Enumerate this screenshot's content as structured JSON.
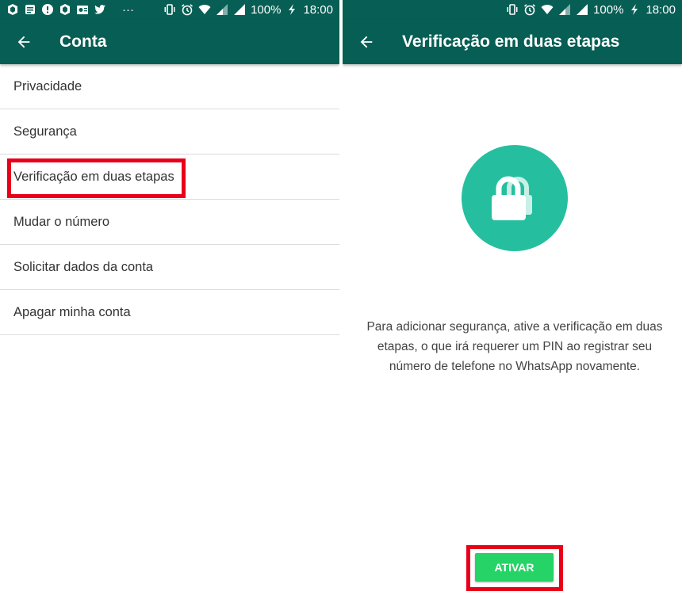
{
  "colors": {
    "header": "#075e54",
    "accent": "#25bfa0",
    "button": "#25d366",
    "highlight": "#e8001a"
  },
  "status_bar": {
    "battery": "100%",
    "time": "18:00",
    "overflow": "···",
    "left_icons": [
      "app-icon",
      "news-icon",
      "info-icon",
      "app-icon",
      "outlook-icon",
      "twitter-icon"
    ],
    "right_icons": [
      "vibrate-icon",
      "alarm-icon",
      "wifi-icon",
      "signal-icon",
      "signal-icon",
      "charging-icon"
    ]
  },
  "account_screen": {
    "title": "Conta",
    "items": [
      {
        "label": "Privacidade"
      },
      {
        "label": "Segurança"
      },
      {
        "label": "Verificação em duas etapas",
        "highlighted": true
      },
      {
        "label": "Mudar o número"
      },
      {
        "label": "Solicitar dados da conta"
      },
      {
        "label": "Apagar minha conta"
      }
    ]
  },
  "two_step_screen": {
    "title": "Verificação em duas etapas",
    "icon": "lock-icon",
    "description": "Para adicionar segurança, ative a verificação em duas etapas, o que irá requerer um PIN ao registrar seu número de telefone no WhatsApp novamente.",
    "button_label": "ATIVAR"
  }
}
